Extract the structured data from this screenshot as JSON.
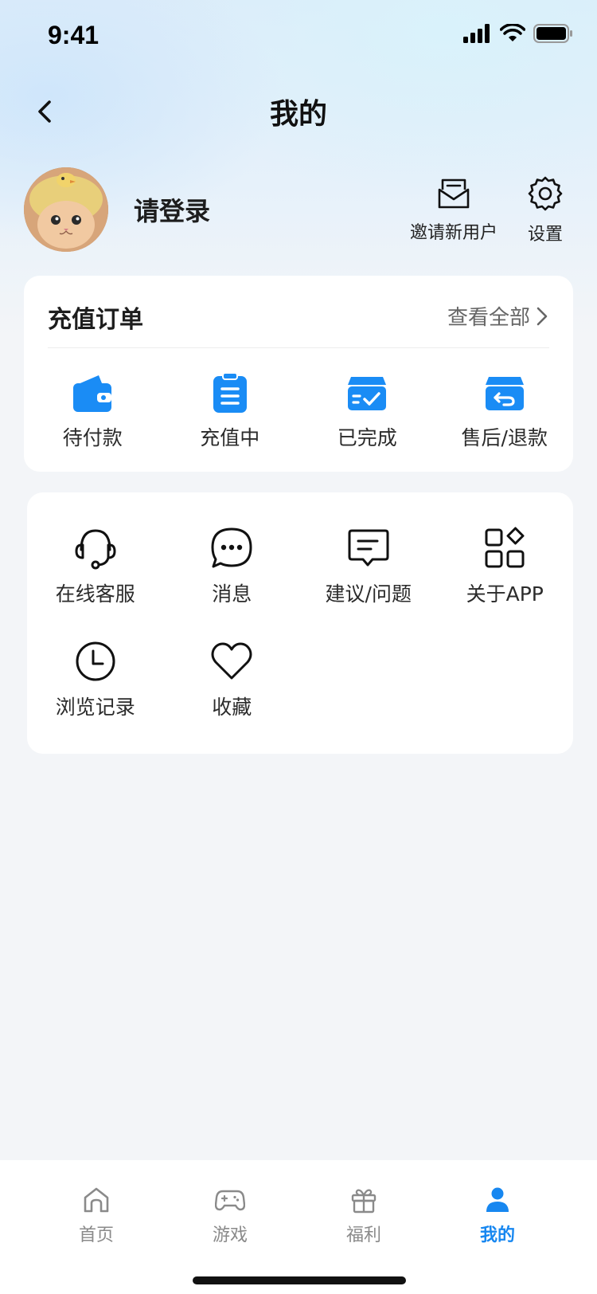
{
  "status_bar": {
    "time": "9:41"
  },
  "nav": {
    "title": "我的"
  },
  "profile": {
    "login_text": "请登录",
    "invite_label": "邀请新用户",
    "settings_label": "设置"
  },
  "orders": {
    "title": "充值订单",
    "view_all": "查看全部",
    "items": [
      {
        "label": "待付款",
        "icon": "wallet-icon"
      },
      {
        "label": "充值中",
        "icon": "clipboard-icon"
      },
      {
        "label": "已完成",
        "icon": "box-check-icon"
      },
      {
        "label": "售后/退款",
        "icon": "box-return-icon"
      }
    ]
  },
  "services": {
    "items": [
      {
        "label": "在线客服",
        "icon": "headset-icon"
      },
      {
        "label": "消息",
        "icon": "chat-bubble-icon"
      },
      {
        "label": "建议/问题",
        "icon": "feedback-icon"
      },
      {
        "label": "关于APP",
        "icon": "apps-grid-icon"
      },
      {
        "label": "浏览记录",
        "icon": "clock-icon"
      },
      {
        "label": "收藏",
        "icon": "heart-icon"
      }
    ]
  },
  "tab_bar": {
    "tabs": [
      {
        "label": "首页",
        "icon": "home-icon",
        "active": false
      },
      {
        "label": "游戏",
        "icon": "gamepad-icon",
        "active": false
      },
      {
        "label": "福利",
        "icon": "gift-icon",
        "active": false
      },
      {
        "label": "我的",
        "icon": "user-icon",
        "active": true
      }
    ]
  },
  "colors": {
    "accent": "#1787f0",
    "icon_blue": "#1a8cf5",
    "background": "#f3f5f8"
  }
}
